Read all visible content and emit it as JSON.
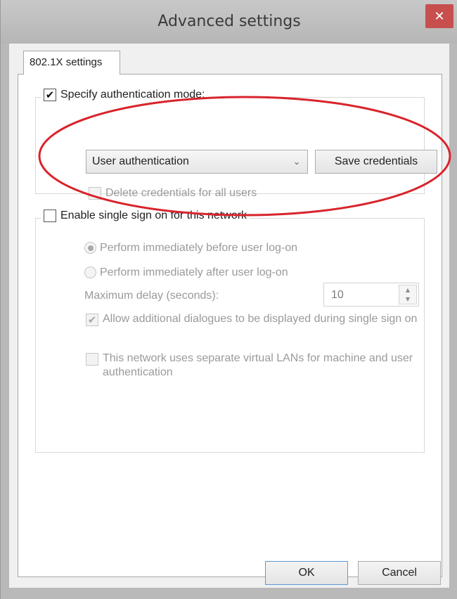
{
  "window": {
    "title": "Advanced settings",
    "close_glyph": "✕"
  },
  "tab": {
    "label": "802.1X settings"
  },
  "auth_group": {
    "specify_label": "Specify authentication mode:",
    "specify_checked": true,
    "mode_select_value": "User authentication",
    "save_credentials_label": "Save credentials",
    "delete_credentials_label": "Delete credentials for all users"
  },
  "sso_group": {
    "enable_label": "Enable single sign on for this network",
    "enable_checked": false,
    "radio_before_label": "Perform immediately before user log-on",
    "radio_after_label": "Perform immediately after user log-on",
    "max_delay_label": "Maximum delay (seconds):",
    "max_delay_value": "10",
    "allow_dialogues_label": "Allow additional dialogues to be displayed during single sign on",
    "separate_vlans_label": "This network uses separate virtual LANs for machine and user authentication"
  },
  "footer": {
    "ok_label": "OK",
    "cancel_label": "Cancel"
  },
  "icons": {
    "check": "✔",
    "chevron_down": "⌄",
    "spin_up": "▲",
    "spin_down": "▼"
  },
  "colors": {
    "close_button": "#c7504f",
    "annotation_ellipse": "#d8242b"
  }
}
